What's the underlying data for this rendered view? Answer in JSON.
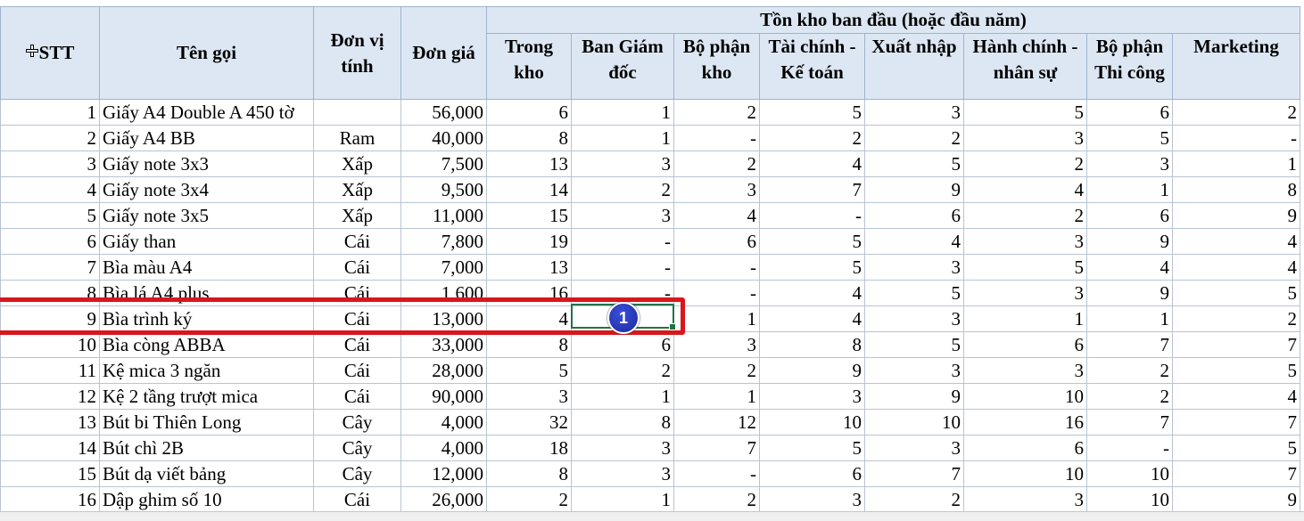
{
  "header": {
    "stt": "STT",
    "ten_goi": "Tên gọi",
    "don_vi_tinh": "Đơn vị tính",
    "don_gia": "Đơn giá",
    "group": "Tồn kho ban đầu (hoặc đầu năm)",
    "departments": [
      "Trong kho",
      "Ban Giám đốc",
      "Bộ phận kho",
      "Tài chính - Kế toán",
      "Xuất nhập",
      "Hành chính - nhân sự",
      "Bộ phận Thi công",
      "Marketing"
    ]
  },
  "rows": [
    {
      "stt": "1",
      "name": "Giấy A4 Double A 450 tờ",
      "unit": "",
      "price": "56,000",
      "vals": [
        "6",
        "1",
        "2",
        "5",
        "3",
        "5",
        "6",
        "2"
      ]
    },
    {
      "stt": "2",
      "name": "Giấy A4 BB",
      "unit": "Ram",
      "price": "40,000",
      "vals": [
        "8",
        "1",
        "-",
        "2",
        "2",
        "3",
        "5",
        "-"
      ]
    },
    {
      "stt": "3",
      "name": "Giấy note 3x3",
      "unit": "Xấp",
      "price": "7,500",
      "vals": [
        "13",
        "3",
        "2",
        "4",
        "5",
        "2",
        "3",
        "1"
      ]
    },
    {
      "stt": "4",
      "name": "Giấy note 3x4",
      "unit": "Xấp",
      "price": "9,500",
      "vals": [
        "14",
        "2",
        "3",
        "7",
        "9",
        "4",
        "1",
        "8"
      ]
    },
    {
      "stt": "5",
      "name": "Giấy note 3x5",
      "unit": "Xấp",
      "price": "11,000",
      "vals": [
        "15",
        "3",
        "4",
        "-",
        "6",
        "2",
        "6",
        "9"
      ]
    },
    {
      "stt": "6",
      "name": "Giấy than",
      "unit": "Cái",
      "price": "7,800",
      "vals": [
        "19",
        "-",
        "6",
        "5",
        "4",
        "3",
        "9",
        "4"
      ]
    },
    {
      "stt": "7",
      "name": "Bìa màu A4",
      "unit": "Cái",
      "price": "7,000",
      "vals": [
        "13",
        "-",
        "-",
        "5",
        "3",
        "5",
        "4",
        "4"
      ]
    },
    {
      "stt": "8",
      "name": "Bìa lá A4 plus",
      "unit": "Cái",
      "price": "1,600",
      "vals": [
        "16",
        "-",
        "-",
        "4",
        "5",
        "3",
        "9",
        "5"
      ]
    },
    {
      "stt": "9",
      "name": "Bìa trình ký",
      "unit": "Cái",
      "price": "13,000",
      "vals": [
        "4",
        "",
        "1",
        "4",
        "3",
        "1",
        "1",
        "2"
      ]
    },
    {
      "stt": "10",
      "name": "Bìa còng ABBA",
      "unit": "Cái",
      "price": "33,000",
      "vals": [
        "8",
        "6",
        "3",
        "8",
        "5",
        "6",
        "7",
        "7"
      ]
    },
    {
      "stt": "11",
      "name": "Kệ mica 3 ngăn",
      "unit": "Cái",
      "price": "28,000",
      "vals": [
        "5",
        "2",
        "2",
        "9",
        "3",
        "3",
        "2",
        "5"
      ]
    },
    {
      "stt": "12",
      "name": "Kệ 2 tầng trượt mica",
      "unit": "Cái",
      "price": "90,000",
      "vals": [
        "3",
        "1",
        "1",
        "3",
        "9",
        "10",
        "2",
        "4"
      ]
    },
    {
      "stt": "13",
      "name": "Bút bi Thiên Long",
      "unit": "Cây",
      "price": "4,000",
      "vals": [
        "32",
        "8",
        "12",
        "10",
        "10",
        "16",
        "7",
        "7"
      ]
    },
    {
      "stt": "14",
      "name": "Bút chì 2B",
      "unit": "Cây",
      "price": "4,000",
      "vals": [
        "18",
        "3",
        "7",
        "5",
        "3",
        "6",
        "-",
        "5"
      ]
    },
    {
      "stt": "15",
      "name": "Bút dạ viết bảng",
      "unit": "Cây",
      "price": "12,000",
      "vals": [
        "8",
        "3",
        "-",
        "6",
        "7",
        "10",
        "10",
        "7"
      ]
    },
    {
      "stt": "16",
      "name": "Dập ghim số 10",
      "unit": "Cái",
      "price": "26,000",
      "vals": [
        "2",
        "1",
        "2",
        "3",
        "2",
        "3",
        "10",
        "9"
      ]
    }
  ],
  "annotation": {
    "step": "1",
    "color": "#d9161c"
  },
  "selection": {
    "cell": "Ban Giám đốc / row 9",
    "color": "#217346"
  },
  "colors": {
    "header_bg": "#dde7f3",
    "grid": "#b9c4d2"
  }
}
